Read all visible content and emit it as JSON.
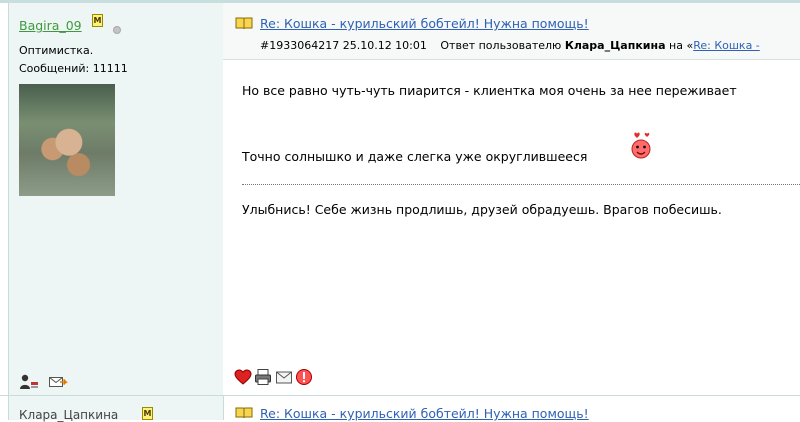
{
  "author": {
    "username": "Bagira_09",
    "moderator_badge": "M",
    "status": "offline",
    "title": "Оптимистка.",
    "post_count": "Сообщений: 11111",
    "avatar": "cat-avatar",
    "icons": [
      "profile-icon",
      "message-icon"
    ]
  },
  "post": {
    "topic_title": "Re: Кошка - курильский бобтейл! Нужна помощь!",
    "post_number": "#1933064217",
    "datetime": "25.10.12 10:01",
    "reply_prefix": "Ответ пользователю",
    "reply_to": "Клара_Цапкина",
    "reply_on": "на «",
    "reply_link": "Re: Кошка -",
    "body_line_1": "Но все равно чуть-чуть пиарится - клиентка моя очень за нее переживает",
    "body_line_2": "Точно солнышко и даже слегка уже округлившееся",
    "signature": "Улыбнись! Себе жизнь продлишь, друзей обрадуешь. Врагов побесишь.",
    "actions": [
      "heart-icon",
      "print-icon",
      "email-icon",
      "report-icon"
    ],
    "colors": {
      "username": "#3f9a3f",
      "link": "#2f61b5",
      "author_bg": "#edf6f4",
      "header_bg": "#f6f9f8"
    }
  },
  "next_post": {
    "username": "Клара_Цапкина",
    "topic_title": "Re: Кошка - курильский бобтейл! Нужна помощь!"
  }
}
